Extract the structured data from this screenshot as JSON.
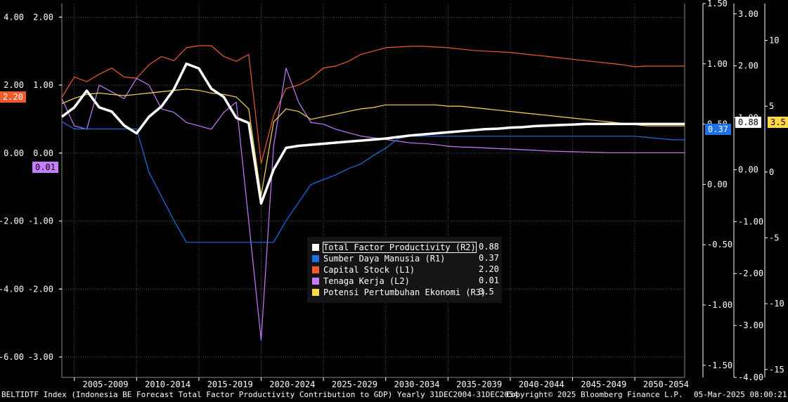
{
  "footer": {
    "left": "BELTIDTF Index (Indonesia BE Forecast Total Factor Productivity Contribution to GDP)  Yearly 31DEC2004-31DEC2054",
    "center": "Copyright© 2025 Bloomberg Finance L.P.",
    "right": "05-Mar-2025 08:00:21"
  },
  "legend": {
    "entries": [
      {
        "name": "Total Factor Productivity (R2)",
        "value": "0.88",
        "color": "#ffffff"
      },
      {
        "name": "Sumber Daya Manusia (R1)",
        "value": "0.37",
        "color": "#1f6fe5"
      },
      {
        "name": "Capital Stock (L1)",
        "value": "2.20",
        "color": "#f15a2b"
      },
      {
        "name": "Tenaga Kerja (L2)",
        "value": "0.01",
        "color": "#c77dff"
      },
      {
        "name": "Potensi Pertumbuhan Ekonomi (R3)",
        "value": "3.5",
        "color": "#ffd84a"
      }
    ]
  },
  "tags": {
    "capital": "2.20",
    "tenaga": "0.01",
    "sdm": "0.37",
    "tfp": "0.88",
    "potensi": "3.5"
  },
  "chart_data": {
    "type": "line",
    "x_labels": [
      "2005-2009",
      "2010-2014",
      "2015-2019",
      "2020-2024",
      "2025-2029",
      "2030-2034",
      "2035-2039",
      "2040-2044",
      "2045-2049",
      "2050-2054"
    ],
    "x": [
      2004,
      2005,
      2006,
      2007,
      2008,
      2009,
      2010,
      2011,
      2012,
      2013,
      2014,
      2015,
      2016,
      2017,
      2018,
      2019,
      2020,
      2021,
      2022,
      2023,
      2024,
      2025,
      2026,
      2027,
      2028,
      2029,
      2030,
      2031,
      2032,
      2033,
      2034,
      2035,
      2036,
      2037,
      2038,
      2039,
      2040,
      2041,
      2042,
      2043,
      2044,
      2045,
      2046,
      2047,
      2048,
      2049,
      2050,
      2051,
      2052,
      2053,
      2054
    ],
    "axes": {
      "L2": {
        "ticks": [
          4.0,
          2.0,
          0.0,
          -2.0,
          -4.0,
          -6.0
        ],
        "range": [
          -6.6,
          4.4
        ]
      },
      "L1": {
        "ticks": [
          2.0,
          1.0,
          0.0,
          -1.0,
          -2.0,
          -3.0
        ],
        "range": [
          -3.3,
          2.2
        ]
      },
      "R1": {
        "ticks": [
          1.5,
          1.0,
          0.5,
          0.0,
          -0.5,
          -1.0,
          -1.5
        ],
        "range": [
          -1.6,
          1.5
        ]
      },
      "R2": {
        "ticks": [
          3.0,
          2.0,
          1.0,
          0.0,
          -1.0,
          -2.0,
          -3.0,
          -4.0
        ],
        "range": [
          -4.0,
          3.2
        ]
      },
      "R3": {
        "ticks": [
          10,
          5,
          0,
          -5,
          -10,
          -15
        ],
        "range": [
          -15.6,
          12.8
        ]
      }
    },
    "series": [
      {
        "name": "Capital Stock (L1)",
        "axis": "L1",
        "color": "#f15a2b",
        "values": [
          0.82,
          1.12,
          1.05,
          1.16,
          1.25,
          1.12,
          1.1,
          1.3,
          1.42,
          1.36,
          1.55,
          1.58,
          1.58,
          1.42,
          1.35,
          1.45,
          -0.15,
          0.55,
          0.95,
          1.0,
          1.1,
          1.25,
          1.28,
          1.35,
          1.45,
          1.5,
          1.55,
          1.56,
          1.57,
          1.57,
          1.56,
          1.55,
          1.53,
          1.51,
          1.5,
          1.49,
          1.48,
          1.46,
          1.44,
          1.42,
          1.4,
          1.38,
          1.36,
          1.34,
          1.32,
          1.3,
          1.27,
          1.28,
          1.28,
          1.28,
          1.28
        ]
      },
      {
        "name": "Tenaga Kerja (L2)",
        "axis": "L2",
        "color": "#c77dff",
        "values": [
          1.6,
          0.8,
          0.7,
          2.0,
          1.8,
          1.6,
          2.2,
          2.0,
          1.3,
          1.2,
          0.9,
          0.8,
          0.7,
          1.2,
          1.5,
          -2.0,
          -5.5,
          0.2,
          2.5,
          1.5,
          0.9,
          0.85,
          0.7,
          0.6,
          0.5,
          0.45,
          0.4,
          0.35,
          0.3,
          0.28,
          0.25,
          0.2,
          0.18,
          0.17,
          0.15,
          0.13,
          0.12,
          0.1,
          0.08,
          0.06,
          0.05,
          0.04,
          0.03,
          0.02,
          0.01,
          0.01,
          0.01,
          0.01,
          0.01,
          0.01,
          0.01
        ]
      },
      {
        "name": "Sumber Daya Manusia (R1)",
        "axis": "R1",
        "color": "#1f6fe5",
        "values": [
          0.52,
          0.46,
          0.46,
          0.46,
          0.46,
          0.46,
          0.46,
          0.1,
          -0.1,
          -0.3,
          -0.48,
          -0.48,
          -0.48,
          -0.48,
          -0.48,
          -0.48,
          -0.48,
          -0.48,
          -0.3,
          -0.15,
          0.0,
          0.04,
          0.08,
          0.13,
          0.17,
          0.24,
          0.3,
          0.38,
          0.4,
          0.4,
          0.4,
          0.4,
          0.4,
          0.4,
          0.4,
          0.4,
          0.4,
          0.4,
          0.4,
          0.4,
          0.4,
          0.4,
          0.4,
          0.4,
          0.4,
          0.4,
          0.4,
          0.39,
          0.38,
          0.37,
          0.37
        ]
      },
      {
        "name": "Total Factor Productivity (R2)",
        "axis": "R2",
        "color": "#ffffff",
        "values": [
          1.02,
          1.2,
          1.52,
          1.2,
          1.12,
          0.85,
          0.7,
          1.02,
          1.22,
          1.55,
          2.04,
          1.95,
          1.56,
          1.4,
          1.0,
          0.9,
          -0.65,
          0.0,
          0.42,
          0.46,
          0.48,
          0.5,
          0.52,
          0.54,
          0.56,
          0.58,
          0.6,
          0.63,
          0.66,
          0.68,
          0.7,
          0.72,
          0.74,
          0.76,
          0.78,
          0.79,
          0.81,
          0.82,
          0.84,
          0.85,
          0.86,
          0.87,
          0.88,
          0.88,
          0.88,
          0.88,
          0.88,
          0.88,
          0.88,
          0.88,
          0.88
        ]
      },
      {
        "name": "Potensi Pertumbuhan Ekonomi (R3)",
        "axis": "R3",
        "color": "#ffd84a",
        "values": [
          5.2,
          5.6,
          5.9,
          6.0,
          5.9,
          5.8,
          5.9,
          6.0,
          6.1,
          6.2,
          6.3,
          6.2,
          6.0,
          5.9,
          5.7,
          4.8,
          -1.8,
          3.8,
          4.8,
          4.6,
          4.0,
          4.2,
          4.4,
          4.6,
          4.8,
          4.9,
          5.1,
          5.1,
          5.1,
          5.1,
          5.1,
          5.0,
          5.0,
          4.9,
          4.8,
          4.7,
          4.6,
          4.5,
          4.4,
          4.3,
          4.2,
          4.1,
          4.0,
          3.9,
          3.8,
          3.7,
          3.6,
          3.5,
          3.5,
          3.5,
          3.5
        ]
      }
    ]
  }
}
